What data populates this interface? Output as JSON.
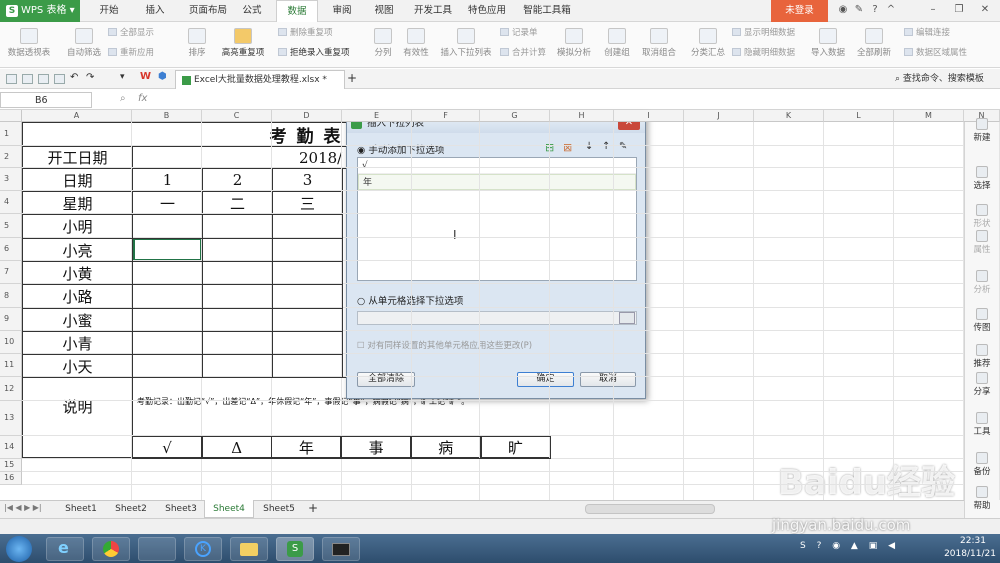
{
  "app": {
    "name": "WPS 表格",
    "login": "未登录"
  },
  "menu_tabs": [
    "开始",
    "插入",
    "页面布局",
    "公式",
    "数据",
    "审阅",
    "视图",
    "开发工具",
    "特色应用",
    "智能工具箱"
  ],
  "ribbon": {
    "large": [
      "数据透视表",
      "自动筛选",
      "排序",
      "高亮重复项",
      "分列",
      "有效性",
      "插入下拉列表",
      "合并计算",
      "模拟分析",
      "创建组",
      "取消组合",
      "分类汇总",
      "导入数据",
      "全部刷新",
      "编辑连接"
    ],
    "small": [
      "全部显示",
      "重新应用",
      "删除重复项",
      "拒绝录入重复项",
      "记录单",
      "显示明细数据",
      "隐藏明细数据",
      "数据区域属性"
    ]
  },
  "doc_tab": "Excel大批量数据处理教程.xlsx *",
  "search_command": "查找命令、搜索模板",
  "name_box": "B6",
  "fx": "fx",
  "columns": [
    "A",
    "B",
    "C",
    "D",
    "E",
    "F",
    "G",
    "H",
    "I",
    "J",
    "K",
    "L",
    "M",
    "N",
    "O"
  ],
  "rows": [
    "1",
    "2",
    "3",
    "4",
    "5",
    "6",
    "7",
    "8",
    "9",
    "10",
    "11",
    "12",
    "13",
    "14",
    "15",
    "16"
  ],
  "sheet": {
    "title": "考  勤  表",
    "start_label": "开工日期",
    "start_date": "2018/",
    "date_label": "日期",
    "days": [
      "1",
      "2",
      "3"
    ],
    "week_label": "星期",
    "weekdays": [
      "一",
      "二",
      "三"
    ],
    "names": [
      "小明",
      "小亮",
      "小黄",
      "小路",
      "小蜜",
      "小青",
      "小天"
    ],
    "note_label": "说明",
    "note_text": "考勤记录：出勤记“√”，出差记“Δ”，年休假记“年”，事假记“事”，病假记“病”，旷工记“旷”。",
    "symbols": [
      "√",
      "Δ",
      "年",
      "事",
      "病",
      "旷"
    ]
  },
  "sheet_tabs": [
    "Sheet1",
    "Sheet2",
    "Sheet3",
    "Sheet4",
    "Sheet5"
  ],
  "active_sheet": "Sheet4",
  "side_panel": [
    "新建",
    "选择",
    "形状",
    "属性",
    "分析",
    "传图",
    "推荐",
    "分享",
    "工具",
    "备份",
    "帮助"
  ],
  "dialog": {
    "title": "插入下拉列表",
    "manual_option": "手动添加下拉选项",
    "items": [
      "√",
      "年"
    ],
    "cell_option": "从单元格选择下拉选项",
    "apply_all": "对有同样设置的其他单元格应用这些更改(P)",
    "clear_all": "全部清除",
    "ok": "确定",
    "cancel": "取消"
  },
  "clock": {
    "time": "22:31",
    "date": "2018/11/21"
  },
  "watermark": "Baidu经验",
  "watermark_url": "jingyan.baidu.com"
}
